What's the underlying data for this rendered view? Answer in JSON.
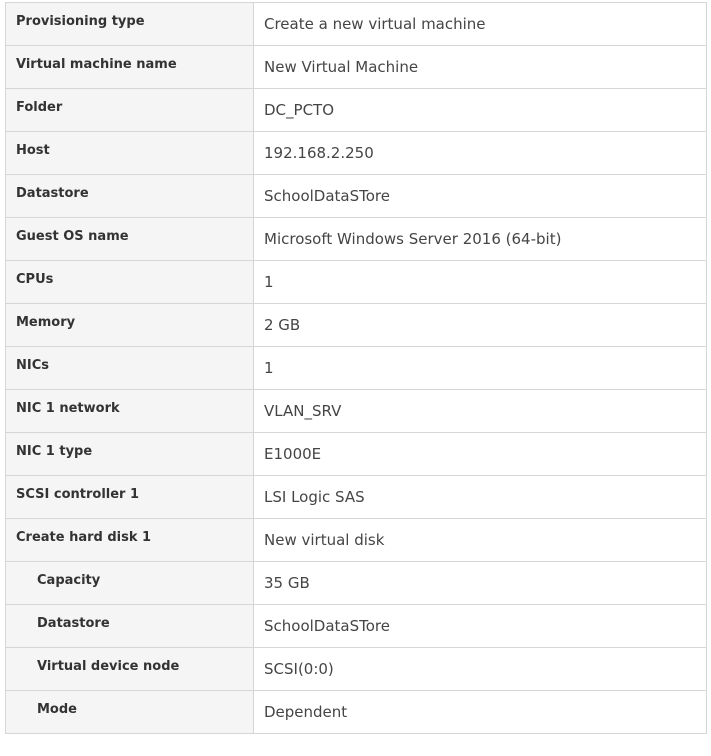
{
  "summary": {
    "rows": [
      {
        "label": "Provisioning type",
        "value": "Create a new virtual machine",
        "indent": false
      },
      {
        "label": "Virtual machine name",
        "value": "New Virtual Machine",
        "indent": false
      },
      {
        "label": "Folder",
        "value": "DC_PCTO",
        "indent": false
      },
      {
        "label": "Host",
        "value": "192.168.2.250",
        "indent": false
      },
      {
        "label": "Datastore",
        "value": "SchoolDataSTore",
        "indent": false
      },
      {
        "label": "Guest OS name",
        "value": "Microsoft Windows Server 2016 (64-bit)",
        "indent": false
      },
      {
        "label": "CPUs",
        "value": "1",
        "indent": false
      },
      {
        "label": "Memory",
        "value": "2 GB",
        "indent": false
      },
      {
        "label": "NICs",
        "value": "1",
        "indent": false
      },
      {
        "label": "NIC 1 network",
        "value": "VLAN_SRV",
        "indent": false
      },
      {
        "label": "NIC 1 type",
        "value": "E1000E",
        "indent": false
      },
      {
        "label": "SCSI controller 1",
        "value": "LSI Logic SAS",
        "indent": false
      },
      {
        "label": "Create hard disk 1",
        "value": "New virtual disk",
        "indent": false
      },
      {
        "label": "Capacity",
        "value": "35 GB",
        "indent": true
      },
      {
        "label": "Datastore",
        "value": "SchoolDataSTore",
        "indent": true
      },
      {
        "label": "Virtual device node",
        "value": "SCSI(0:0)",
        "indent": true
      },
      {
        "label": "Mode",
        "value": "Dependent",
        "indent": true
      }
    ]
  }
}
